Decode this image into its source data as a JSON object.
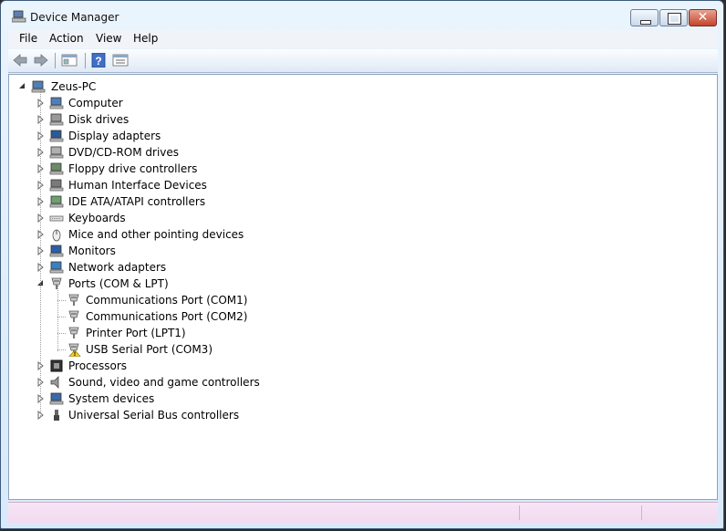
{
  "window": {
    "title": "Device Manager"
  },
  "menu": [
    {
      "label": "File"
    },
    {
      "label": "Action"
    },
    {
      "label": "View"
    },
    {
      "label": "Help"
    }
  ],
  "toolbar": {
    "buttons": [
      "back-arrow-icon",
      "forward-arrow-icon",
      "show-hide-console-tree-icon",
      "help-icon",
      "properties-icon"
    ]
  },
  "tree": {
    "root": {
      "label": "Zeus-PC",
      "icon": "computer-network-icon"
    },
    "categories": [
      {
        "label": "Computer",
        "icon": "computer-icon"
      },
      {
        "label": "Disk drives",
        "icon": "disk-drive-icon"
      },
      {
        "label": "Display adapters",
        "icon": "display-adapter-icon"
      },
      {
        "label": "DVD/CD-ROM drives",
        "icon": "dvd-drive-icon"
      },
      {
        "label": "Floppy drive controllers",
        "icon": "floppy-controller-icon"
      },
      {
        "label": "Human Interface Devices",
        "icon": "hid-icon"
      },
      {
        "label": "IDE ATA/ATAPI controllers",
        "icon": "ide-controller-icon"
      },
      {
        "label": "Keyboards",
        "icon": "keyboard-icon"
      },
      {
        "label": "Mice and other pointing devices",
        "icon": "mouse-icon"
      },
      {
        "label": "Monitors",
        "icon": "monitor-icon"
      },
      {
        "label": "Network adapters",
        "icon": "network-adapter-icon"
      },
      {
        "label": "Ports (COM & LPT)",
        "icon": "port-icon",
        "expanded": true
      },
      {
        "label": "Processors",
        "icon": "processor-icon"
      },
      {
        "label": "Sound, video and game controllers",
        "icon": "speaker-icon"
      },
      {
        "label": "System devices",
        "icon": "system-device-icon"
      },
      {
        "label": "Universal Serial Bus controllers",
        "icon": "usb-icon"
      }
    ],
    "ports": [
      {
        "label": "Communications Port (COM1)",
        "icon": "port-icon"
      },
      {
        "label": "Communications Port (COM2)",
        "icon": "port-icon"
      },
      {
        "label": "Printer Port (LPT1)",
        "icon": "port-icon"
      },
      {
        "label": "USB Serial Port (COM3)",
        "icon": "port-warning-icon",
        "warning": true
      }
    ]
  }
}
